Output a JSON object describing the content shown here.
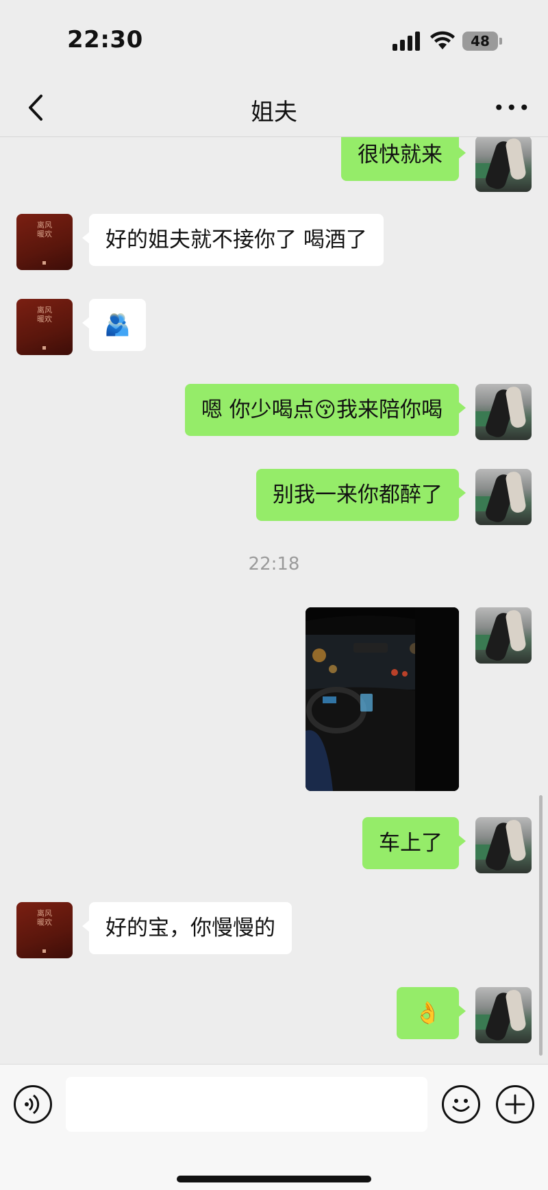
{
  "status_bar": {
    "time": "22:30",
    "battery": "48"
  },
  "header": {
    "title": "姐夫",
    "back_icon": "chevron-left-icon",
    "more_icon": "more-icon"
  },
  "messages": [
    {
      "sender": "me",
      "type": "text",
      "text": "很快就来"
    },
    {
      "sender": "other",
      "type": "text",
      "text": "好的姐夫就不接你了 喝酒了"
    },
    {
      "sender": "other",
      "type": "emoji",
      "text": "🫂"
    },
    {
      "sender": "me",
      "type": "text",
      "text": "嗯 你少喝点😚我来陪你喝"
    },
    {
      "sender": "me",
      "type": "text",
      "text": "别我一来你都醉了"
    },
    {
      "type": "timestamp",
      "text": "22:18"
    },
    {
      "sender": "me",
      "type": "image"
    },
    {
      "sender": "me",
      "type": "text",
      "text": "车上了"
    },
    {
      "sender": "other",
      "type": "text",
      "text": "好的宝，你慢慢的"
    },
    {
      "sender": "me",
      "type": "emoji",
      "text": "👌"
    }
  ],
  "other_avatar": {
    "seal_text": "离风暖欢"
  },
  "input_bar": {
    "voice_icon": "voice-icon",
    "emoji_icon": "emoji-icon",
    "plus_icon": "plus-icon",
    "placeholder": ""
  },
  "colors": {
    "bubble_me": "#95ec69",
    "bubble_other": "#ffffff",
    "background": "#ededed"
  }
}
